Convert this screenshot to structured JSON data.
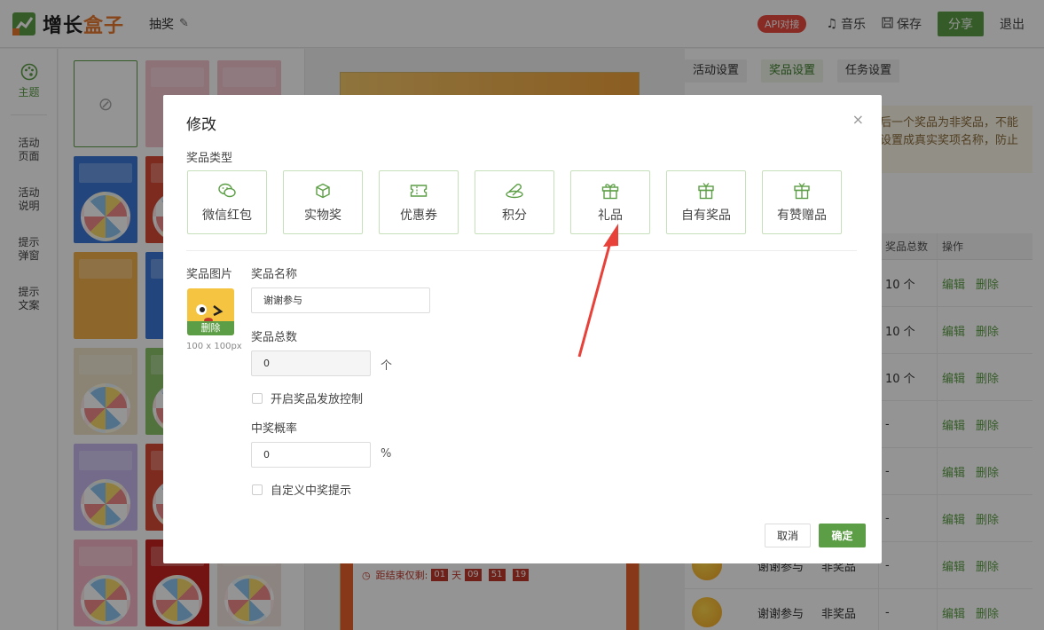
{
  "app": {
    "logo_prefix": "增长",
    "logo_highlight": "盒子",
    "page_title": "抽奖"
  },
  "topbar": {
    "api_badge": "API对接",
    "music": "音乐",
    "save": "保存",
    "share": "分享",
    "exit": "退出"
  },
  "leftnav": {
    "items": [
      {
        "label": "主题"
      },
      {
        "label": "活动\n页面"
      },
      {
        "label": "活动\n说明"
      },
      {
        "label": "提示\n弹窗"
      },
      {
        "label": "提示\n文案"
      }
    ]
  },
  "preview": {
    "countdown_label": "距结束仅剩:",
    "days": "01",
    "day_unit": "天",
    "hours": "09",
    "minutes": "51",
    "seconds": "19"
  },
  "settings": {
    "tabs": [
      "活动设置",
      "奖品设置",
      "任务设置"
    ],
    "notice_line1": "后一个奖品为非奖品，不能",
    "notice_line2": "设置成真实奖项名称，防止",
    "columns": {
      "total": "奖品总数",
      "ops": "操作"
    },
    "rows": [
      {
        "name": "",
        "type": "",
        "total": "10 个"
      },
      {
        "name": "",
        "type": "",
        "total": "10 个"
      },
      {
        "name": "",
        "type": "",
        "total": "10 个"
      },
      {
        "name": "",
        "type": "",
        "total": "-"
      },
      {
        "name": "",
        "type": "",
        "total": "-"
      },
      {
        "name": "",
        "type": "",
        "total": "-"
      },
      {
        "name": "谢谢参与",
        "type": "非奖品",
        "total": "-"
      },
      {
        "name": "谢谢参与",
        "type": "非奖品",
        "total": "-"
      }
    ],
    "edit": "编辑",
    "delete": "删除"
  },
  "modal": {
    "title": "修改",
    "close": "×",
    "type_label": "奖品类型",
    "types": [
      {
        "label": "微信红包",
        "icon": "wechat-icon"
      },
      {
        "label": "实物奖",
        "icon": "cube-icon"
      },
      {
        "label": "优惠券",
        "icon": "coupon-icon"
      },
      {
        "label": "积分",
        "icon": "coins-icon"
      },
      {
        "label": "礼品",
        "icon": "gift-icon"
      },
      {
        "label": "自有奖品",
        "icon": "gift-box-icon"
      },
      {
        "label": "有赞赠品",
        "icon": "gift-box-icon"
      }
    ],
    "image_label": "奖品图片",
    "image_delete": "删除",
    "image_size": "100 x 100px",
    "name_label": "奖品名称",
    "name_value": "谢谢参与",
    "total_label": "奖品总数",
    "total_value": "0",
    "total_unit": "个",
    "control_label": "开启奖品发放控制",
    "prob_label": "中奖概率",
    "prob_value": "0",
    "prob_unit": "%",
    "custom_label": "自定义中奖提示",
    "cancel": "取消",
    "ok": "确定"
  },
  "colors": {
    "accent": "#5c9e45",
    "annotation_arrow": "#e8413a"
  }
}
